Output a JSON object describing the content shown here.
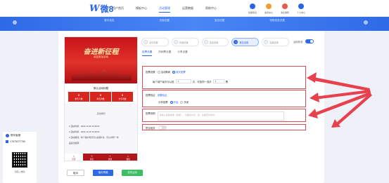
{
  "header": {
    "logo_letter": "W",
    "logo_text": "微8",
    "nav": [
      "用户首页",
      "模板中心",
      "活动管理",
      "运营数据",
      "帮助中心"
    ],
    "active_nav_index": 2,
    "icons": [
      {
        "label": "批量导出",
        "color": "#2a63e8",
        "icon": "export-icon"
      },
      {
        "label": "会员中心",
        "color": "#f0a030",
        "icon": "member-icon"
      },
      {
        "label": "消息通知",
        "color": "#e85a4f",
        "icon": "bell-icon"
      },
      {
        "label": "个人中心",
        "color": "#2a63e8",
        "icon": "user-icon"
      }
    ]
  },
  "band_steps": [
    "基本信息",
    "页面设置",
    "奖品设置",
    "领取信息设置"
  ],
  "preview": {
    "banner_title": "奋进新征程",
    "banner_sub": "欢迎参加活动",
    "info_title": "默认活动标题",
    "stats": [
      {
        "value": "0",
        "label": "参与人数"
      },
      {
        "value": "0",
        "label": "浏览次数"
      },
      {
        "value": "0",
        "label": "分享次数"
      }
    ],
    "rule_title": "活动规则",
    "lines": [
      "1.活动时间：2024-12-06 10:48:21",
      "2.活动时间：2024-12-15 10:48:21",
      "3.活动规则：每个用户每天可以投票1次，可以对同一作",
      "   品多次投票"
    ],
    "cta": "投票",
    "tabs": [
      "首页",
      "排名",
      "参赛",
      "我的"
    ]
  },
  "bottom_buttons": {
    "back": "取消",
    "save": "保存草稿",
    "publish": "发布活动"
  },
  "stepbar": [
    {
      "n": "1",
      "label": "活动设置"
    },
    {
      "n": "2",
      "label": "页面设置"
    },
    {
      "n": "3",
      "label": "奖品设置"
    },
    {
      "n": "4",
      "label": "报名设置"
    },
    {
      "n": "5",
      "label": "高级设置"
    }
  ],
  "active_step": 4,
  "activity_switch_label": "活动状态",
  "subtabs": [
    "投票设置",
    "防刷票设置",
    "分享设置"
  ],
  "active_subtab": 0,
  "settings": {
    "vote_mode_label": "投票设置",
    "vote_mode_opt1": "活动期间",
    "vote_mode_opt2": "按天投票",
    "vote_rule_prefix": "每个用户每天可以投",
    "vote_count": "1",
    "vote_rule_mid": "次，可投同一选手",
    "vote_same": "1",
    "vote_rule_suffix": "票",
    "verify_label": "投票验证",
    "verify_link": "设置验证",
    "share_label": "分享投票",
    "share_opt1": "开启",
    "share_opt2": "关闭",
    "desc_label": "投票说明",
    "desc_placeholder": "请输入投票说明（选填），不超过50字，如：在规定时间内…",
    "weixin_label": "是否强关"
  },
  "sidebar": {
    "contact": "联系客服",
    "phone": "17675277780",
    "qr_label": "扫码二维码"
  }
}
